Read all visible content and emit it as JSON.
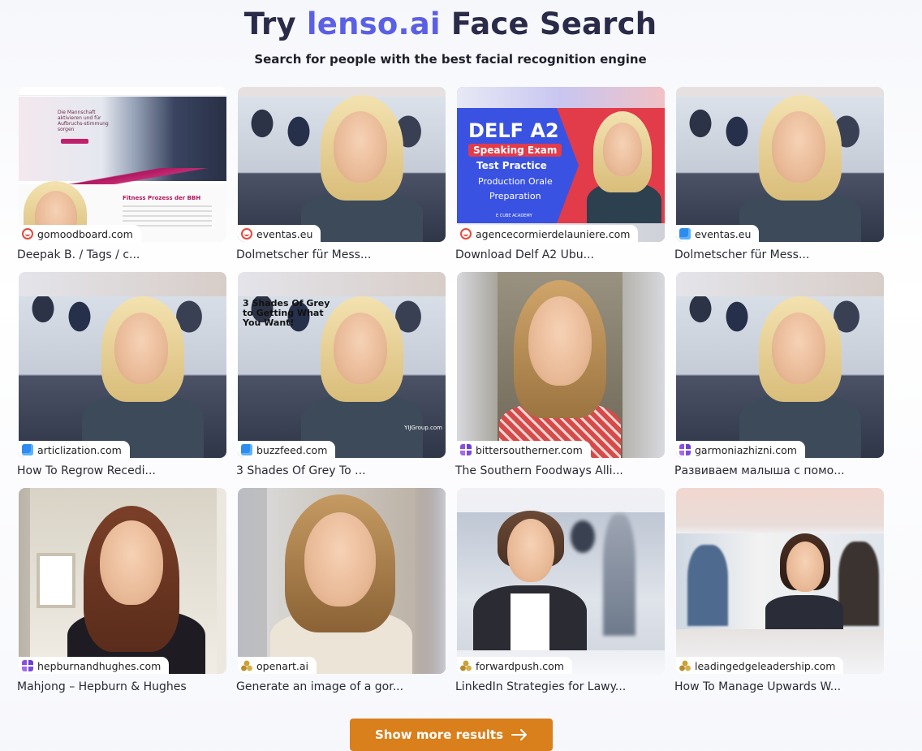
{
  "header": {
    "title_prefix": "Try",
    "title_brand": "lenso.ai",
    "title_suffix": "Face Search",
    "subtitle": "Search for people with the best facial recognition engine"
  },
  "results": [
    {
      "domain": "gomoodboard.com",
      "caption": "Deepak B. / Tags / c...",
      "favicon": "red-face-icon"
    },
    {
      "domain": "eventas.eu",
      "caption": "Dolmetscher für Mess...",
      "favicon": "red-face-icon"
    },
    {
      "domain": "agencecormierdelauniere.com",
      "caption": "Download Delf A2 Übu...",
      "favicon": "red-face-icon"
    },
    {
      "domain": "eventas.eu",
      "caption": "Dolmetscher für Mess...",
      "favicon": "blue-square-icon"
    },
    {
      "domain": "articlization.com",
      "caption": "How To Regrow Recedi...",
      "favicon": "blue-square-icon"
    },
    {
      "domain": "buzzfeed.com",
      "caption": "3 Shades Of Grey To ...",
      "favicon": "blue-square-icon"
    },
    {
      "domain": "bittersoutherner.com",
      "caption": "The Southern Foodways Alli...",
      "favicon": "purple-grid-icon"
    },
    {
      "domain": "garmoniazhizni.com",
      "caption": "Развиваем малыша с помо...",
      "favicon": "purple-grid-icon"
    },
    {
      "domain": "hepburnandhughes.com",
      "caption": "Mahjong – Hepburn & Hughes",
      "favicon": "purple-grid-icon"
    },
    {
      "domain": "openart.ai",
      "caption": "Generate an image of a gor...",
      "favicon": "gold-dots-icon"
    },
    {
      "domain": "forwardpush.com",
      "caption": "LinkedIn Strategies for Lawy...",
      "favicon": "gold-dots-icon"
    },
    {
      "domain": "leadingedgeleadership.com",
      "caption": "How To Manage Upwards W...",
      "favicon": "gold-dots-icon"
    }
  ],
  "image_text": {
    "delf_title": "DELF A2",
    "delf_badge": "Speaking Exam",
    "delf_test": "Test Practice",
    "delf_prod": "Production Orale",
    "delf_prep": "Preparation",
    "delf_academy": "E CUBE ACADEMY",
    "shades_text": "3 Shades Of Grey to Getting What You Want!",
    "shades_watermark": "YIJGroup.com",
    "mood_text": "Die Mannschaft aktivieren und für Aufbruchs-stimmung sorgen",
    "mood_section": "Fitness Prozess der BBH"
  },
  "footer": {
    "show_more_label": "Show more results",
    "arrow_icon": "arrow-right-icon"
  }
}
